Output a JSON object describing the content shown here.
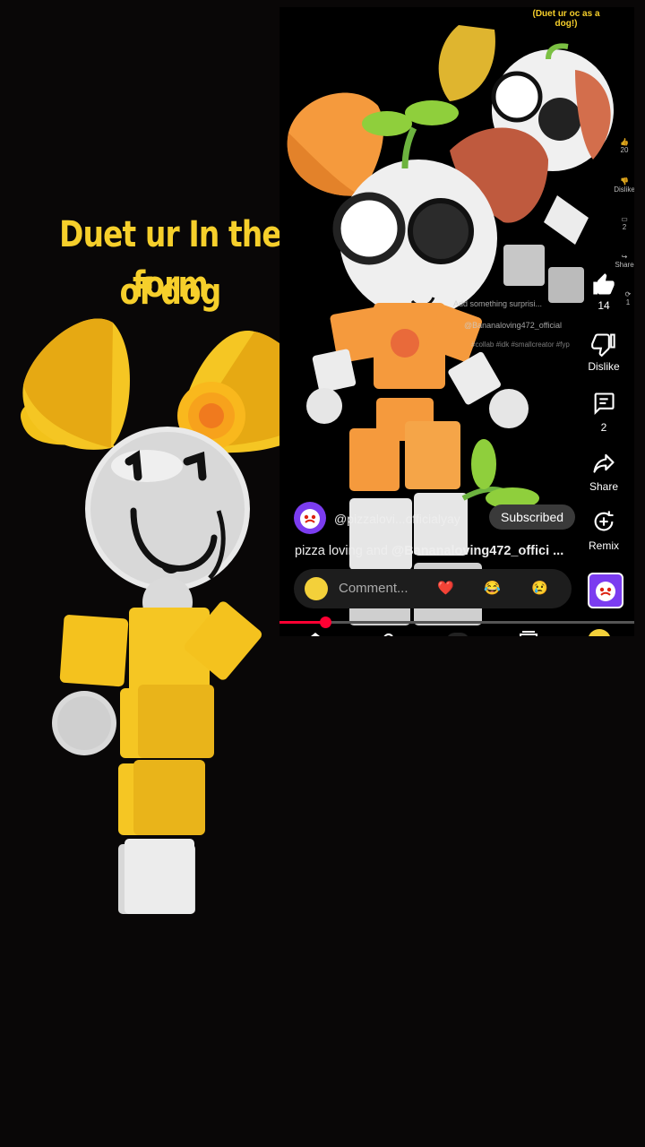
{
  "overlay_text": {
    "line1": "Duet ur In the form",
    "line2": "of dog"
  },
  "duet_video": {
    "top_caption": "(Duet ur oc as a dog!)",
    "small_rail": {
      "likes": "20",
      "dislike": "Dislike",
      "comments": "2",
      "share": "Share",
      "remix_count": "1"
    },
    "embedded_suggestion": "Add something surprisi...",
    "embedded_handle": "@Bananaloving472_official",
    "embedded_tags": "#collab #idk #smallcreator #fyp"
  },
  "rail": {
    "likes": "14",
    "dislike": "Dislike",
    "comments": "2",
    "share": "Share",
    "remix": "Remix"
  },
  "channel": {
    "handle": "@pizzalovi...officialyay",
    "subscribe_label": "Subscribed"
  },
  "description": {
    "prefix": "pizza loving and ",
    "mention": "@Bananaloving472_offici ..."
  },
  "comment": {
    "placeholder": "Comment...",
    "emojis": [
      "❤️",
      "😂",
      "😢"
    ]
  },
  "progress": {
    "fraction": 0.13
  },
  "colors": {
    "title_yellow": "#f6cf2b",
    "accent_red": "#ff0033",
    "orange": "#f59a3d"
  }
}
